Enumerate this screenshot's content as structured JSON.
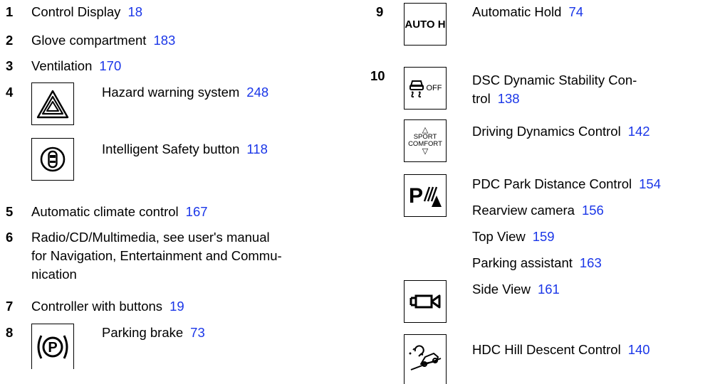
{
  "left": [
    {
      "num": "1",
      "label": "Control Display",
      "page": "18"
    },
    {
      "num": "2",
      "label": "Glove compartment",
      "page": "183"
    },
    {
      "num": "3",
      "label": "Ventilation",
      "page": "170"
    },
    {
      "num": "4",
      "label": "Hazard warning system",
      "page": "248",
      "icon": "hazard-triangle-icon"
    },
    {
      "label": "Intelligent Safety button",
      "page": "118",
      "icon": "intelligent-safety-icon"
    },
    {
      "num": "5",
      "label": "Automatic climate control",
      "page": "167"
    },
    {
      "num": "6",
      "lines": [
        "Radio/CD/Multimedia, see user's manual",
        "for Navigation, Entertainment and Commu-",
        "nication"
      ]
    },
    {
      "num": "7",
      "label": "Controller with buttons",
      "page": "19"
    },
    {
      "num": "8",
      "label": "Parking brake",
      "page": "73",
      "icon": "parking-brake-icon"
    }
  ],
  "right": [
    {
      "num": "9",
      "label": "Automatic Hold",
      "page": "74",
      "icon": "auto-hold-icon",
      "icon_text": "AUTO H"
    },
    {
      "num": "10",
      "label_line1": "DSC Dynamic Stability Con-",
      "label_line2": "trol",
      "page": "138",
      "icon": "dsc-off-icon",
      "icon_text": "OFF"
    },
    {
      "label": "Driving Dynamics Control",
      "page": "142",
      "icon": "driving-dynamics-icon",
      "icon_text": [
        "SPORT",
        "COMFORT"
      ]
    },
    {
      "label": "PDC Park Distance Control",
      "page": "154",
      "icon": "pdc-icon",
      "icon_text": "P"
    },
    {
      "label": "Rearview camera",
      "page": "156"
    },
    {
      "label": "Top View",
      "page": "159"
    },
    {
      "label": "Parking assistant",
      "page": "163"
    },
    {
      "label": "Side View",
      "page": "161",
      "icon": "side-view-camera-icon"
    },
    {
      "label": "HDC Hill Descent Control",
      "page": "140",
      "icon": "hdc-icon"
    }
  ],
  "colors": {
    "page_ref": "#1a36e8",
    "text": "#000000"
  }
}
